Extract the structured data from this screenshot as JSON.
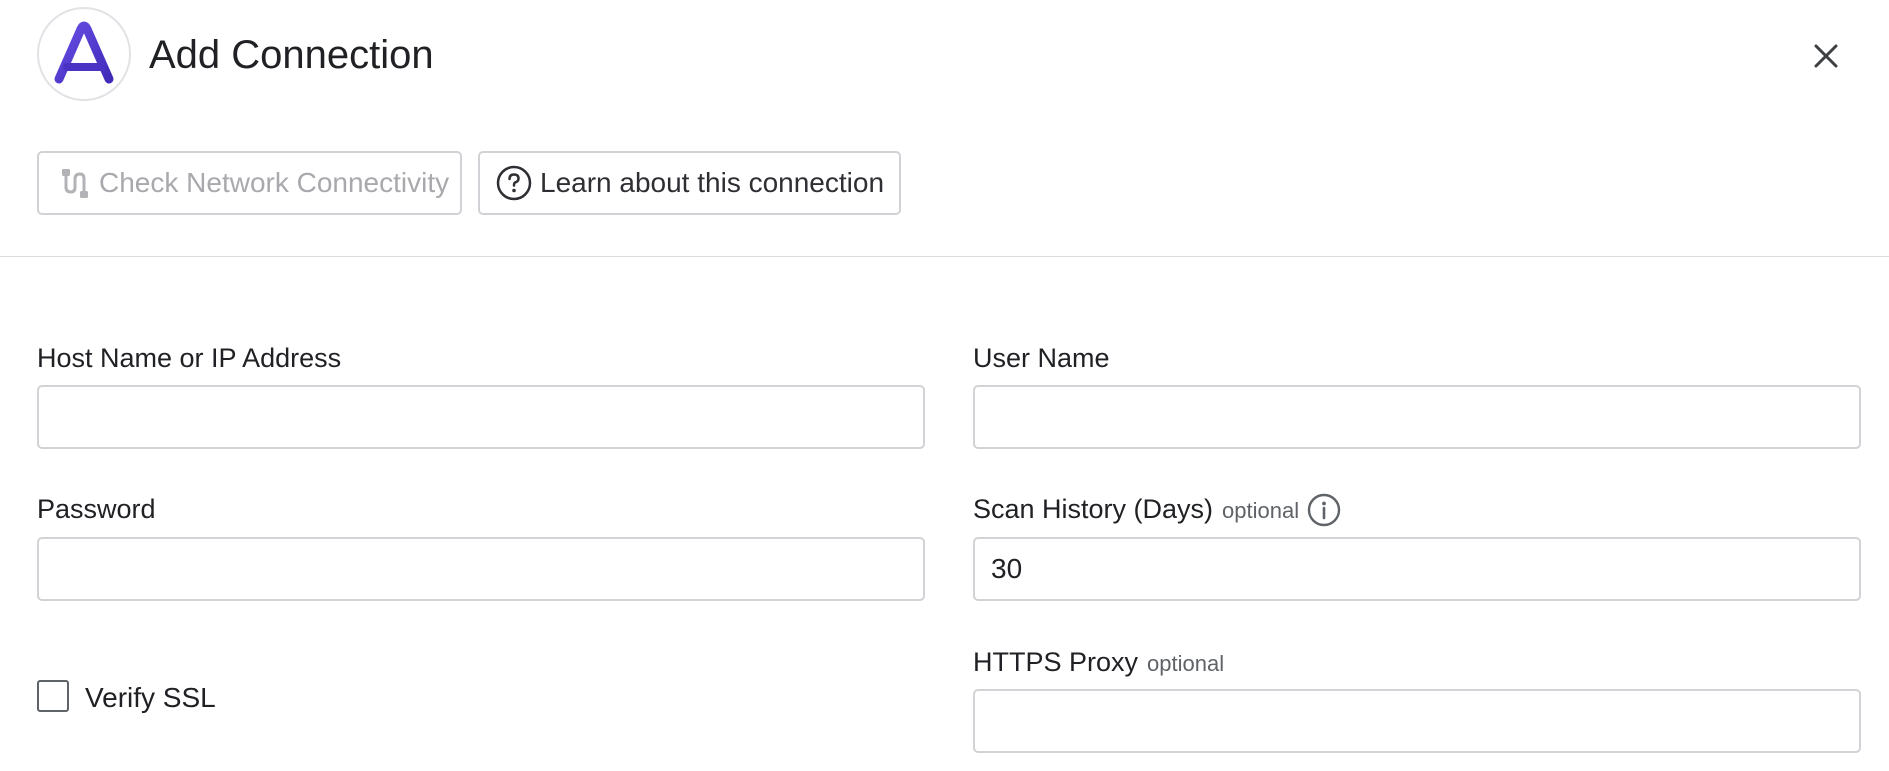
{
  "header": {
    "title": "Add Connection",
    "logo_icon": "adverity-a-logo",
    "close_icon": "close-icon",
    "accent_color": "#5b3fd6"
  },
  "toolbar": {
    "check_network_label": "Check Network Connectivity",
    "check_network_disabled": true,
    "learn_label": "Learn about this connection"
  },
  "form": {
    "host": {
      "label": "Host Name or IP Address",
      "value": ""
    },
    "user": {
      "label": "User Name",
      "value": ""
    },
    "password": {
      "label": "Password",
      "value": ""
    },
    "scan_history": {
      "label": "Scan History (Days)",
      "optional": "optional",
      "value": "30"
    },
    "verify_ssl": {
      "label": "Verify SSL",
      "checked": false
    },
    "https_proxy": {
      "label": "HTTPS Proxy",
      "optional": "optional",
      "value": ""
    }
  }
}
